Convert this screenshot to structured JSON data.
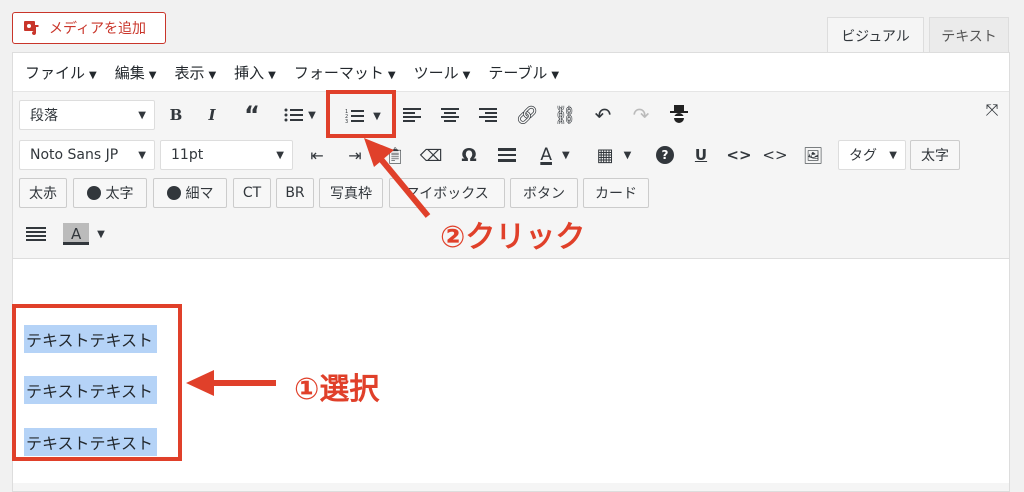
{
  "media_button": {
    "label": "メディアを追加"
  },
  "tabs": {
    "visual": "ビジュアル",
    "text": "テキスト"
  },
  "menubar": [
    {
      "label": "ファイル"
    },
    {
      "label": "編集"
    },
    {
      "label": "表示"
    },
    {
      "label": "挿入"
    },
    {
      "label": "フォーマット"
    },
    {
      "label": "ツール"
    },
    {
      "label": "テーブル"
    }
  ],
  "toolbar1": {
    "paragraph": "段落"
  },
  "toolbar2": {
    "font": "Noto Sans JP",
    "size": "11pt",
    "tag": "タグ",
    "bold_jp": "太字"
  },
  "quicktags": [
    "太赤",
    "太字",
    "細マ",
    "CT",
    "BR",
    "写真枠",
    "マイボックス",
    "ボタン",
    "カード"
  ],
  "content": {
    "lines": [
      "テキストテキスト",
      "テキストテキスト",
      "テキストテキスト"
    ]
  },
  "annotations": {
    "step1": "①選択",
    "step2": "②クリック"
  },
  "colors": {
    "accent": "#e0402a",
    "selection": "#b5d3f7"
  }
}
